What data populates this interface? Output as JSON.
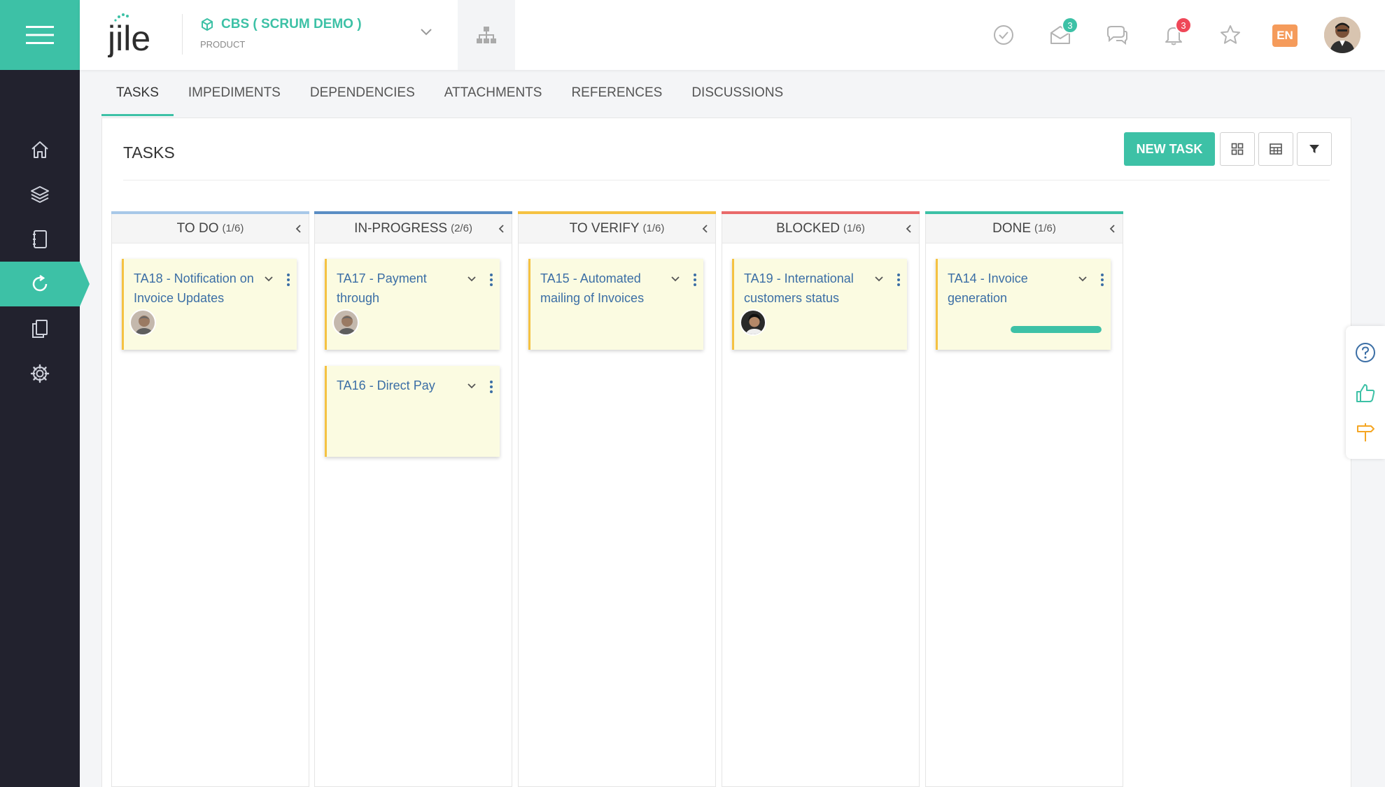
{
  "app": {
    "logo_text": "jile"
  },
  "project": {
    "name": "CBS ( SCRUM DEMO )",
    "type": "PRODUCT"
  },
  "header": {
    "mail_badge": "3",
    "notification_badge": "3",
    "language": "EN"
  },
  "colors": {
    "accent": "#3dc1a6",
    "sidebar": "#22222e",
    "card_bg": "#fbfbe1",
    "card_border": "#f5c242",
    "link": "#3b6ea5",
    "badge_red": "#ef4758",
    "lang_orange": "#f59b5b"
  },
  "tabs": [
    {
      "label": "TASKS",
      "active": true
    },
    {
      "label": "IMPEDIMENTS"
    },
    {
      "label": "DEPENDENCIES"
    },
    {
      "label": "ATTACHMENTS"
    },
    {
      "label": "REFERENCES"
    },
    {
      "label": "DISCUSSIONS"
    }
  ],
  "panel": {
    "title": "TASKS",
    "new_task_label": "NEW TASK"
  },
  "columns": [
    {
      "title": "TO DO",
      "count": "(1/6)",
      "color": "#a7c8e8",
      "cards": [
        {
          "title": "TA18 - Notification on Invoice Updates",
          "avatar": true
        }
      ]
    },
    {
      "title": "IN-PROGRESS",
      "count": "(2/6)",
      "color": "#5a8dc4",
      "cards": [
        {
          "title": "TA17 - Payment through",
          "avatar": true
        },
        {
          "title": "TA16 - Direct Pay",
          "avatar": false
        }
      ]
    },
    {
      "title": "TO VERIFY",
      "count": "(1/6)",
      "color": "#f5c242",
      "cards": [
        {
          "title": "TA15 - Automated mailing of Invoices",
          "avatar": false
        }
      ]
    },
    {
      "title": "BLOCKED",
      "count": "(1/6)",
      "color": "#e96a6a",
      "cards": [
        {
          "title": "TA19 - International customers status",
          "avatar": true
        }
      ]
    },
    {
      "title": "DONE",
      "count": "(1/6)",
      "color": "#3dc1a6",
      "cards": [
        {
          "title": "TA14 - Invoice generation",
          "avatar": false,
          "progress": 1.0
        }
      ]
    }
  ]
}
